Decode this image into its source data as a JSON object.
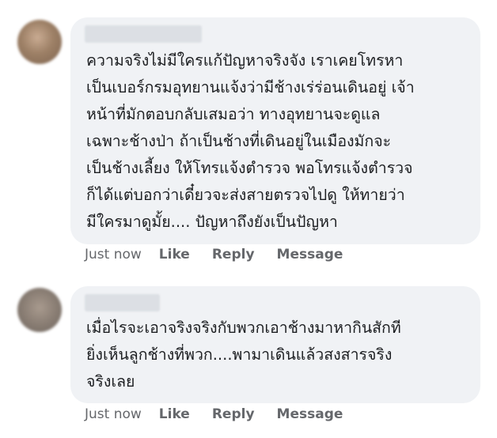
{
  "comments": [
    {
      "lines": [
        "ความจริงไม่มีใครแก้ปัญหาจริงจัง เราเคยโทรหา",
        "เป็นเบอร์กรมอุทยานแจ้งว่ามีช้างเร่ร่อนเดินอยู่ เจ้า",
        "หน้าที่มักตอบกลับเสมอว่า ทางอุทยานจะดูแล",
        "เฉพาะช้างป่า ถ้าเป็นช้างที่เดินอยู่ในเมืองมักจะ",
        "เป็นช้างเลี้ยง ให้โทรแจ้งตำรวจ พอโทรแจ้งตำรวจ",
        "ก็ได้แต่บอกว่าเดี๋ยวจะส่งสายตรวจไปดู ให้ทายว่า",
        "มีใครมาดูมั้ย.... ปัญหาถึงยังเป็นปัญหา"
      ],
      "timestamp": "Just now",
      "like_label": "Like",
      "reply_label": "Reply",
      "message_label": "Message"
    },
    {
      "lines": [
        "เมื่อไรจะเอาจริงจริงกับพวกเอาช้างมาหากินสักที",
        "ยิ่งเห็นลูกช้างที่พวก....พามาเดินแล้วสงสารจริง",
        "จริงเลย"
      ],
      "timestamp": "Just now",
      "like_label": "Like",
      "reply_label": "Reply",
      "message_label": "Message"
    }
  ]
}
